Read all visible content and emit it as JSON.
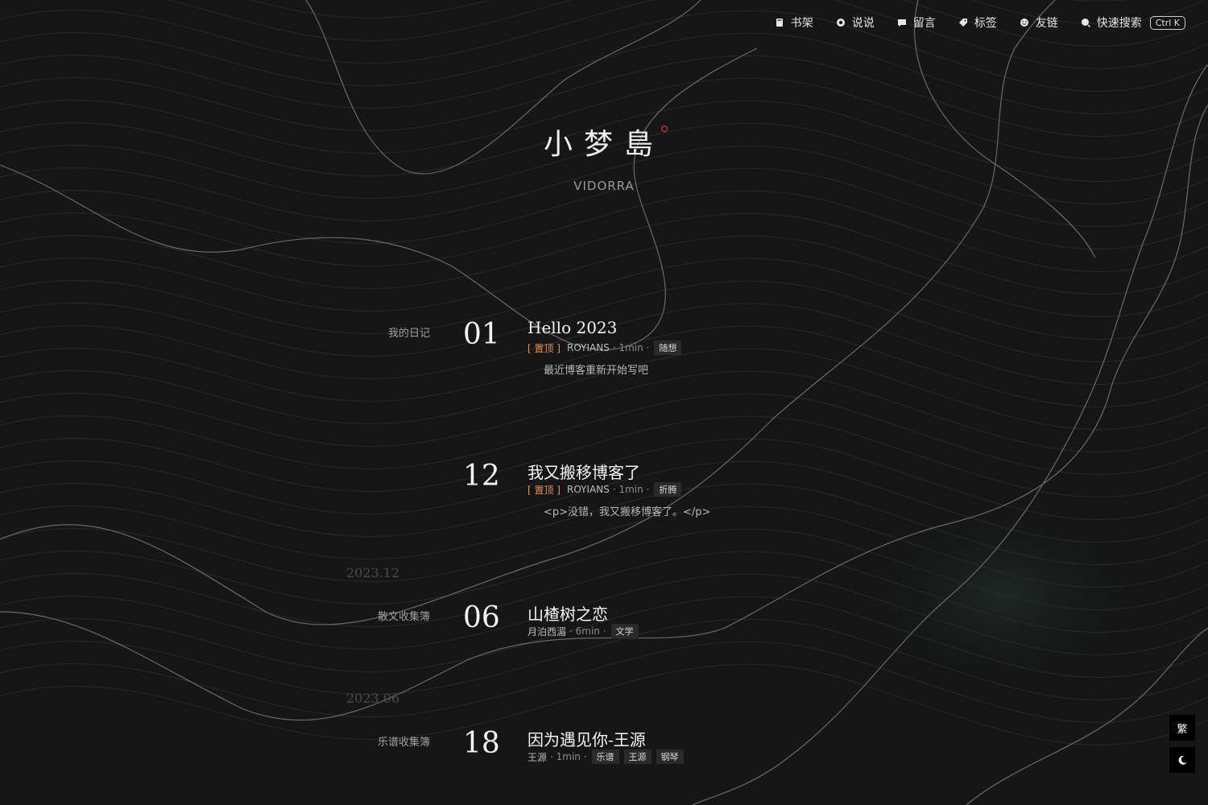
{
  "nav": {
    "items": [
      {
        "label": "书架",
        "icon": "book-icon"
      },
      {
        "label": "说说",
        "icon": "chat-circle-icon"
      },
      {
        "label": "留言",
        "icon": "message-icon"
      },
      {
        "label": "标签",
        "icon": "tag-icon"
      },
      {
        "label": "友链",
        "icon": "smile-icon"
      },
      {
        "label": "快速搜索",
        "icon": "search-icon"
      }
    ],
    "shortcut": "Ctrl K"
  },
  "logo": {
    "mark": "小梦島",
    "subtitle": "VIDORRA"
  },
  "posts": [
    {
      "category": "我的日记",
      "number": "01",
      "title": "Hello 2023",
      "pinned": "[ 置顶 ]",
      "author": "ROYIANS",
      "read_time": "· 1min ·",
      "tags": [
        "随想"
      ],
      "excerpt": "最近博客重新开始写吧"
    },
    {
      "category": "",
      "number": "12",
      "title": "我又搬移博客了",
      "pinned": "[ 置顶 ]",
      "author": "ROYIANS",
      "read_time": "· 1min ·",
      "tags": [
        "折腾"
      ],
      "excerpt": "<p>没错，我又搬移博客了。</p>"
    },
    {
      "category": "散文收集簿",
      "number": "06",
      "title": "山楂树之恋",
      "pinned": "",
      "author": "月泊西湄",
      "read_time": "· 6min ·",
      "tags": [
        "文学"
      ],
      "excerpt": ""
    },
    {
      "category": "乐谱收集簿",
      "number": "18",
      "title": "因为遇见你-王源",
      "pinned": "",
      "author": "王源",
      "read_time": "· 1min ·",
      "tags": [
        "乐谱",
        "王源",
        "钢琴"
      ],
      "excerpt": ""
    }
  ],
  "years": [
    "2023.12",
    "2023.06"
  ],
  "floating": {
    "traditional_label": "繁",
    "theme_icon": "moon-icon"
  },
  "colors": {
    "background": "#161616",
    "pin": "#e8934d",
    "logo_dot": "#e0433a"
  }
}
